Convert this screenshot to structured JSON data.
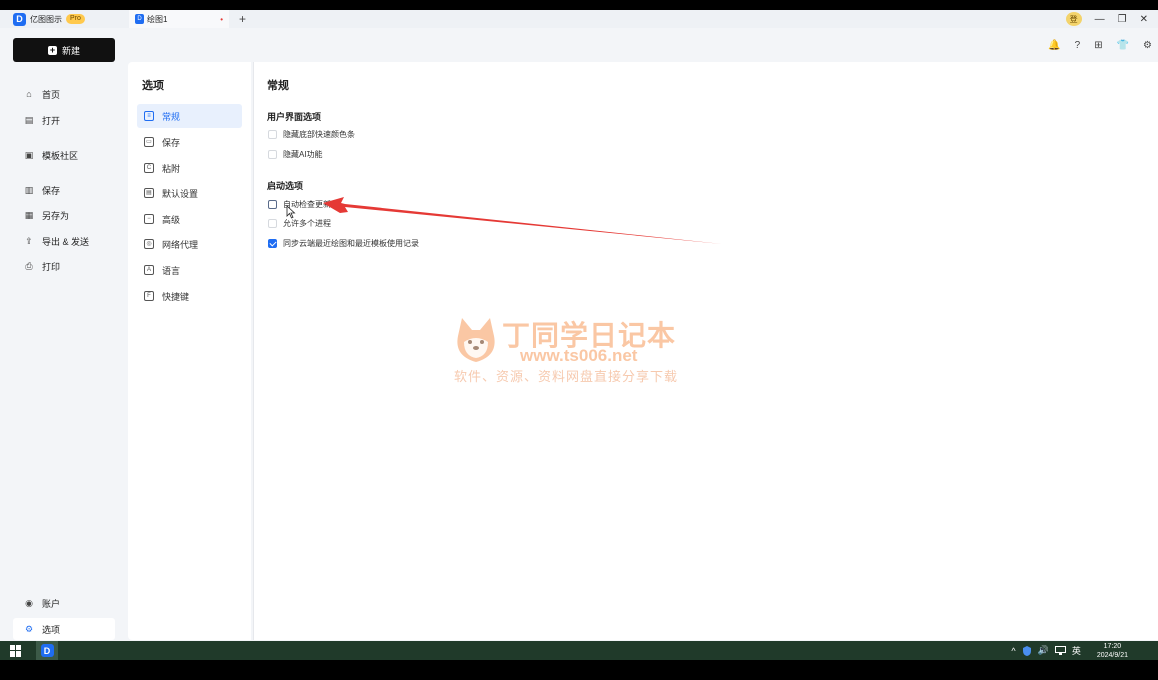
{
  "app": {
    "name": "亿图图示",
    "badge": "Pro",
    "logo_letter": "D"
  },
  "tab": {
    "title": "绘图1",
    "icon_letter": "D",
    "unsaved_dot": "•",
    "add": "+"
  },
  "window": {
    "login_chip": "登",
    "minimize": "—",
    "restore": "❐",
    "close": "✕"
  },
  "toolbar": {
    "new_label": "新建",
    "new_plus": "+",
    "bell": "🔔",
    "help": "?",
    "apps": "⊞",
    "shirt": "👕",
    "settings": "⚙"
  },
  "sidebar": {
    "items": [
      {
        "label": "首页",
        "icon": "home-icon",
        "glyph": "⌂"
      },
      {
        "label": "打开",
        "icon": "file-icon",
        "glyph": "▤"
      },
      {
        "label": "模板社区",
        "icon": "community-icon",
        "glyph": "▣"
      },
      {
        "label": "保存",
        "icon": "save-icon",
        "glyph": "▥"
      },
      {
        "label": "另存为",
        "icon": "save-as-icon",
        "glyph": "▦"
      },
      {
        "label": "导出 & 发送",
        "icon": "export-icon",
        "glyph": "⇪"
      },
      {
        "label": "打印",
        "icon": "print-icon",
        "glyph": "⎙"
      },
      {
        "label": "账户",
        "icon": "account-icon",
        "glyph": "◉"
      },
      {
        "label": "选项",
        "icon": "gear-icon",
        "glyph": "⚙"
      }
    ]
  },
  "options": {
    "title": "选项",
    "items": [
      {
        "label": "常规",
        "glyph": "≡"
      },
      {
        "label": "保存",
        "glyph": "▭"
      },
      {
        "label": "粘附",
        "glyph": "C"
      },
      {
        "label": "默认设置",
        "glyph": "▤"
      },
      {
        "label": "高级",
        "glyph": "−"
      },
      {
        "label": "网络代理",
        "glyph": "◎"
      },
      {
        "label": "语言",
        "glyph": "A"
      },
      {
        "label": "快捷键",
        "glyph": "F"
      }
    ]
  },
  "content": {
    "title": "常规",
    "ui_section": {
      "title": "用户界面选项",
      "options": [
        {
          "label": "隐藏底部快速颜色条",
          "checked": false
        },
        {
          "label": "隐藏AI功能",
          "checked": false
        }
      ]
    },
    "startup_section": {
      "title": "启动选项",
      "options": [
        {
          "label": "自动检查更新",
          "checked": false
        },
        {
          "label": "允许多个进程",
          "checked": false
        },
        {
          "label": "同步云端最近绘图和最近模板使用记录",
          "checked": true
        }
      ]
    }
  },
  "watermark": {
    "title": "丁同学日记本",
    "url": "www.ts006.net",
    "subtitle": "软件、资源、资料网盘直接分享下载"
  },
  "taskbar": {
    "app_letter": "D",
    "tray_up": "^",
    "tray_lang": "英",
    "tray_vol": "🔊",
    "time": "17:20",
    "date": "2024/9/21"
  },
  "colors": {
    "accent": "#1f6df2",
    "annotation_arrow": "#e53935",
    "watermark": "#f7a268"
  }
}
